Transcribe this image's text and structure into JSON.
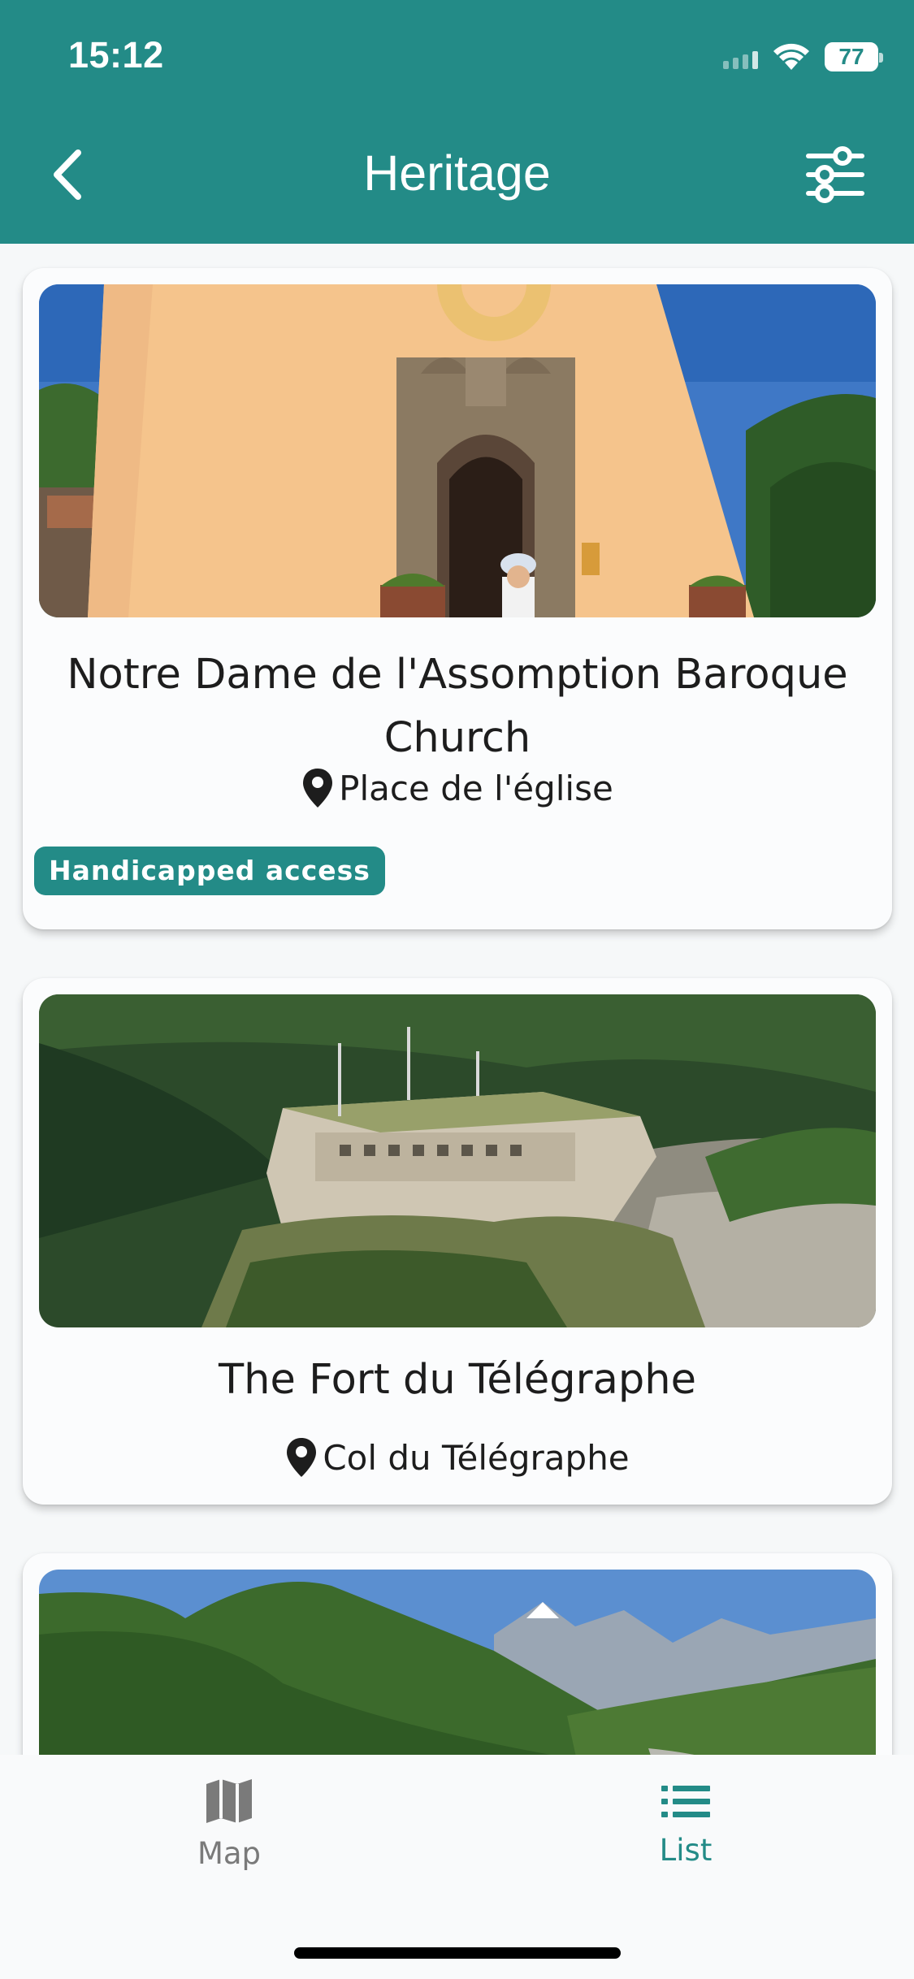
{
  "status_bar": {
    "time": "15:12",
    "battery": "77"
  },
  "header": {
    "title": "Heritage",
    "back_icon": "chevron-left-icon",
    "filter_icon": "sliders-icon"
  },
  "cards": [
    {
      "title": "Notre Dame de l'Assomption Baroque Church",
      "location": "Place de l'église",
      "badge": "Handicapped access"
    },
    {
      "title": "The Fort du Télégraphe",
      "location": "Col du Télégraphe"
    }
  ],
  "bottom_nav": {
    "map_label": "Map",
    "list_label": "List",
    "active": "List"
  },
  "colors": {
    "primary": "#238b87",
    "background": "#f6f8f9",
    "card": "#fbfcfd"
  }
}
